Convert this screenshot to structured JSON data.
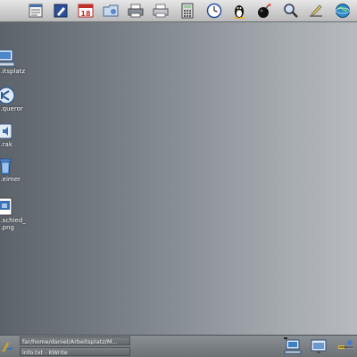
{
  "toolbar": {
    "icons": [
      "notes-icon",
      "kwrite-icon",
      "calendar-icon",
      "folder-icon",
      "printer-icon",
      "printer-2-icon",
      "calculator-icon",
      "clock-icon",
      "linux-tux-icon",
      "bomb-icon",
      "search-magnifier-icon",
      "sketch-icon",
      "globe-icon"
    ]
  },
  "desktop": {
    "items": [
      {
        "label": "...itsplatz",
        "icon": "computer-icon"
      },
      {
        "label": "...queror",
        "icon": "konqueror-icon"
      },
      {
        "label": "...rak",
        "icon": "speaker-icon"
      },
      {
        "label": "...eimer",
        "icon": "trash-icon"
      },
      {
        "label": "...schied_",
        "label2": "...png",
        "icon": "image-file-icon"
      }
    ]
  },
  "panel": {
    "tasks": [
      {
        "label": "far/home/daniel/Arbeitsplatz/M..."
      },
      {
        "label": "info.txt - KWrite"
      }
    ],
    "tray_icons": [
      "monitor-icon",
      "screen-icon",
      "network-icon"
    ]
  }
}
